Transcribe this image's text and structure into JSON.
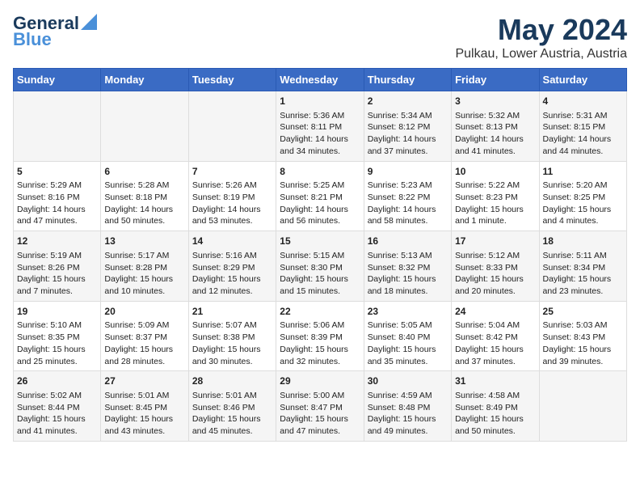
{
  "header": {
    "logo_line1": "General",
    "logo_line2": "Blue",
    "title": "May 2024",
    "subtitle": "Pulkau, Lower Austria, Austria"
  },
  "days_of_week": [
    "Sunday",
    "Monday",
    "Tuesday",
    "Wednesday",
    "Thursday",
    "Friday",
    "Saturday"
  ],
  "weeks": [
    {
      "cells": [
        {
          "day": "",
          "info": ""
        },
        {
          "day": "",
          "info": ""
        },
        {
          "day": "",
          "info": ""
        },
        {
          "day": "1",
          "info": "Sunrise: 5:36 AM\nSunset: 8:11 PM\nDaylight: 14 hours\nand 34 minutes."
        },
        {
          "day": "2",
          "info": "Sunrise: 5:34 AM\nSunset: 8:12 PM\nDaylight: 14 hours\nand 37 minutes."
        },
        {
          "day": "3",
          "info": "Sunrise: 5:32 AM\nSunset: 8:13 PM\nDaylight: 14 hours\nand 41 minutes."
        },
        {
          "day": "4",
          "info": "Sunrise: 5:31 AM\nSunset: 8:15 PM\nDaylight: 14 hours\nand 44 minutes."
        }
      ]
    },
    {
      "cells": [
        {
          "day": "5",
          "info": "Sunrise: 5:29 AM\nSunset: 8:16 PM\nDaylight: 14 hours\nand 47 minutes."
        },
        {
          "day": "6",
          "info": "Sunrise: 5:28 AM\nSunset: 8:18 PM\nDaylight: 14 hours\nand 50 minutes."
        },
        {
          "day": "7",
          "info": "Sunrise: 5:26 AM\nSunset: 8:19 PM\nDaylight: 14 hours\nand 53 minutes."
        },
        {
          "day": "8",
          "info": "Sunrise: 5:25 AM\nSunset: 8:21 PM\nDaylight: 14 hours\nand 56 minutes."
        },
        {
          "day": "9",
          "info": "Sunrise: 5:23 AM\nSunset: 8:22 PM\nDaylight: 14 hours\nand 58 minutes."
        },
        {
          "day": "10",
          "info": "Sunrise: 5:22 AM\nSunset: 8:23 PM\nDaylight: 15 hours\nand 1 minute."
        },
        {
          "day": "11",
          "info": "Sunrise: 5:20 AM\nSunset: 8:25 PM\nDaylight: 15 hours\nand 4 minutes."
        }
      ]
    },
    {
      "cells": [
        {
          "day": "12",
          "info": "Sunrise: 5:19 AM\nSunset: 8:26 PM\nDaylight: 15 hours\nand 7 minutes."
        },
        {
          "day": "13",
          "info": "Sunrise: 5:17 AM\nSunset: 8:28 PM\nDaylight: 15 hours\nand 10 minutes."
        },
        {
          "day": "14",
          "info": "Sunrise: 5:16 AM\nSunset: 8:29 PM\nDaylight: 15 hours\nand 12 minutes."
        },
        {
          "day": "15",
          "info": "Sunrise: 5:15 AM\nSunset: 8:30 PM\nDaylight: 15 hours\nand 15 minutes."
        },
        {
          "day": "16",
          "info": "Sunrise: 5:13 AM\nSunset: 8:32 PM\nDaylight: 15 hours\nand 18 minutes."
        },
        {
          "day": "17",
          "info": "Sunrise: 5:12 AM\nSunset: 8:33 PM\nDaylight: 15 hours\nand 20 minutes."
        },
        {
          "day": "18",
          "info": "Sunrise: 5:11 AM\nSunset: 8:34 PM\nDaylight: 15 hours\nand 23 minutes."
        }
      ]
    },
    {
      "cells": [
        {
          "day": "19",
          "info": "Sunrise: 5:10 AM\nSunset: 8:35 PM\nDaylight: 15 hours\nand 25 minutes."
        },
        {
          "day": "20",
          "info": "Sunrise: 5:09 AM\nSunset: 8:37 PM\nDaylight: 15 hours\nand 28 minutes."
        },
        {
          "day": "21",
          "info": "Sunrise: 5:07 AM\nSunset: 8:38 PM\nDaylight: 15 hours\nand 30 minutes."
        },
        {
          "day": "22",
          "info": "Sunrise: 5:06 AM\nSunset: 8:39 PM\nDaylight: 15 hours\nand 32 minutes."
        },
        {
          "day": "23",
          "info": "Sunrise: 5:05 AM\nSunset: 8:40 PM\nDaylight: 15 hours\nand 35 minutes."
        },
        {
          "day": "24",
          "info": "Sunrise: 5:04 AM\nSunset: 8:42 PM\nDaylight: 15 hours\nand 37 minutes."
        },
        {
          "day": "25",
          "info": "Sunrise: 5:03 AM\nSunset: 8:43 PM\nDaylight: 15 hours\nand 39 minutes."
        }
      ]
    },
    {
      "cells": [
        {
          "day": "26",
          "info": "Sunrise: 5:02 AM\nSunset: 8:44 PM\nDaylight: 15 hours\nand 41 minutes."
        },
        {
          "day": "27",
          "info": "Sunrise: 5:01 AM\nSunset: 8:45 PM\nDaylight: 15 hours\nand 43 minutes."
        },
        {
          "day": "28",
          "info": "Sunrise: 5:01 AM\nSunset: 8:46 PM\nDaylight: 15 hours\nand 45 minutes."
        },
        {
          "day": "29",
          "info": "Sunrise: 5:00 AM\nSunset: 8:47 PM\nDaylight: 15 hours\nand 47 minutes."
        },
        {
          "day": "30",
          "info": "Sunrise: 4:59 AM\nSunset: 8:48 PM\nDaylight: 15 hours\nand 49 minutes."
        },
        {
          "day": "31",
          "info": "Sunrise: 4:58 AM\nSunset: 8:49 PM\nDaylight: 15 hours\nand 50 minutes."
        },
        {
          "day": "",
          "info": ""
        }
      ]
    }
  ]
}
